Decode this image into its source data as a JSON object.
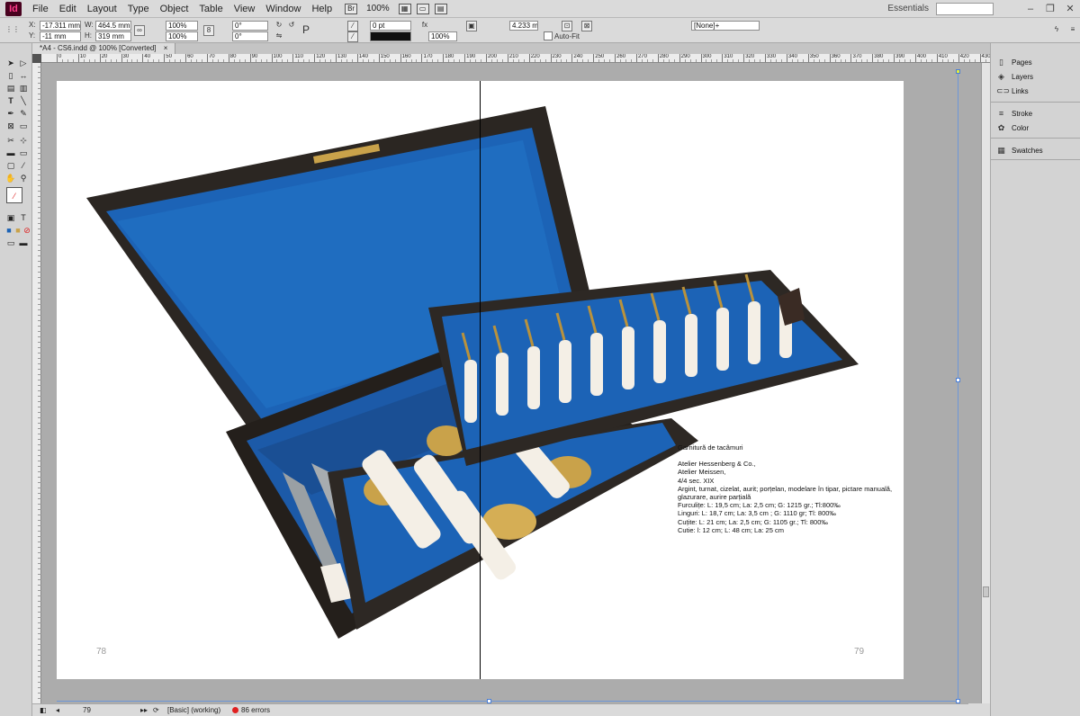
{
  "app": {
    "logo": "Id"
  },
  "menu": {
    "items": [
      "File",
      "Edit",
      "Layout",
      "Type",
      "Object",
      "Table",
      "View",
      "Window",
      "Help"
    ],
    "zoom": "100%",
    "workspace": "Essentials",
    "search_placeholder": ""
  },
  "control": {
    "x": "-17.311 mm",
    "y": "-11 mm",
    "w": "464.5 mm",
    "h": "319 mm",
    "scale_x": "100%",
    "scale_y": "100%",
    "rotate": "0°",
    "shear": "0°",
    "stroke_weight": "0 pt",
    "opacity": "100%",
    "gap": "4.233 mm",
    "style": "[None]+",
    "autofit": "Auto-Fit"
  },
  "document": {
    "tab_title": "*A4 - CS6.indd @ 100% [Converted]",
    "close": "×"
  },
  "ruler": {
    "ticks": [
      "0",
      "10",
      "20",
      "30",
      "40",
      "50",
      "60",
      "70",
      "80",
      "90",
      "100",
      "110",
      "120",
      "130",
      "140",
      "150",
      "160",
      "170",
      "180",
      "190",
      "200",
      "210",
      "220",
      "230",
      "240",
      "250",
      "260",
      "270",
      "280",
      "290",
      "300",
      "310",
      "320",
      "330",
      "340",
      "350",
      "360",
      "370",
      "380",
      "390",
      "400",
      "410",
      "420",
      "430",
      "440",
      "450"
    ]
  },
  "pages": {
    "left_number": "78",
    "right_number": "79"
  },
  "caption": {
    "title": "Garnitură de tacâmuri",
    "lines": [
      "Atelier Hessenberg & Co.,",
      "Atelier Meissen,",
      "4/4 sec. XIX",
      "Argint, turnat, cizelat, aurit;  porțelan, modelare în tipar, pictare manuală,",
      "glazurare, aurire parțială",
      "Furculițe: L: 19,5 cm; La: 2,5 cm; G: 1215 gr.; Tl:800‰",
      "Linguri: L: 18,7 cm; La: 3,5 cm ; G: 1110 gr;  Tl: 800‰",
      "Cuțite: L: 21 cm; La: 2,5 cm; G: 1105 gr.;  Tl: 800‰",
      "Cutie: l: 12 cm; L: 48 cm; La: 25 cm"
    ]
  },
  "panels": [
    {
      "label": "Pages",
      "icon": "pages-icon"
    },
    {
      "label": "Layers",
      "icon": "layers-icon"
    },
    {
      "label": "Links",
      "icon": "links-icon"
    },
    {
      "label": "Stroke",
      "icon": "stroke-icon"
    },
    {
      "label": "Color",
      "icon": "color-icon"
    },
    {
      "label": "Swatches",
      "icon": "swatches-icon"
    }
  ],
  "status": {
    "page": "79",
    "preflight_profile": "[Basic] (working)",
    "errors": "86 errors"
  },
  "colors": {
    "box_blue": "#1c63b6",
    "box_dark": "#2b2622",
    "gold": "#c9a24a",
    "selection": "#4a7ed4"
  }
}
